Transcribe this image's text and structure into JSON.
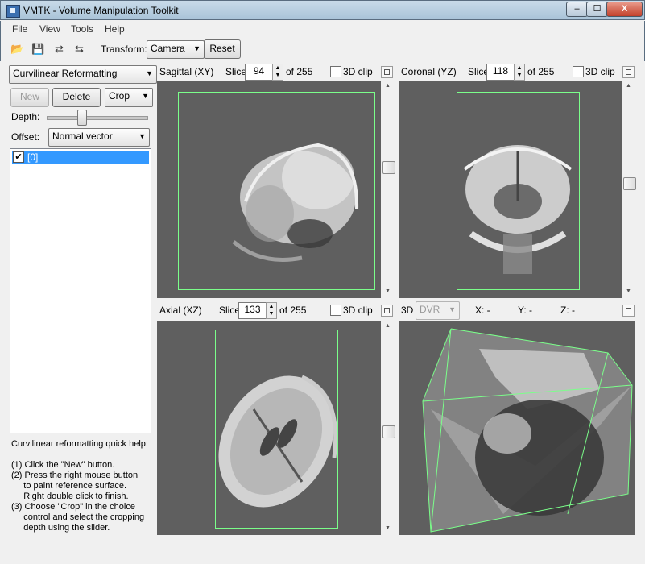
{
  "window": {
    "title": "VMTK - Volume Manipulation Toolkit",
    "minimize": "‒",
    "maximize": "☐",
    "close": "X"
  },
  "menu": [
    "File",
    "View",
    "Tools",
    "Help"
  ],
  "toolbar": {
    "transform_label": "Transform:",
    "transform_value": "Camera",
    "reset_label": "Reset"
  },
  "left_panel": {
    "mode_value": "Curvilinear Reformatting",
    "new_label": "New",
    "delete_label": "Delete",
    "crop_value": "Crop",
    "depth_label": "Depth:",
    "depth_value": 0.55,
    "offset_label": "Offset:",
    "offset_value": "Normal vector",
    "list_items": [
      {
        "label": "[0]",
        "checked": true
      }
    ],
    "help_title": "Curvilinear reformatting quick help:",
    "help_lines": [
      "(1) Click the \"New\" button.",
      "(2) Press the right mouse button",
      "     to paint reference surface.",
      "     Right double click to finish.",
      "(3) Choose \"Crop\" in the choice",
      "     control and select the cropping",
      "     depth using the slider."
    ]
  },
  "views": {
    "sagittal": {
      "name": "Sagittal (XY)",
      "slice_label": "Slice",
      "slice": "94",
      "of_label": "of 255",
      "clip_label": "3D clip"
    },
    "coronal": {
      "name": "Coronal (YZ)",
      "slice_label": "Slice",
      "slice": "118",
      "of_label": "of 255",
      "clip_label": "3D clip"
    },
    "axial": {
      "name": "Axial (XZ)",
      "slice_label": "Slice",
      "slice": "133",
      "of_label": "of 255",
      "clip_label": "3D clip"
    },
    "threed": {
      "name": "3D",
      "mode": "DVR",
      "x_label": "X: -",
      "y_label": "Y: -",
      "z_label": "Z: -"
    }
  }
}
